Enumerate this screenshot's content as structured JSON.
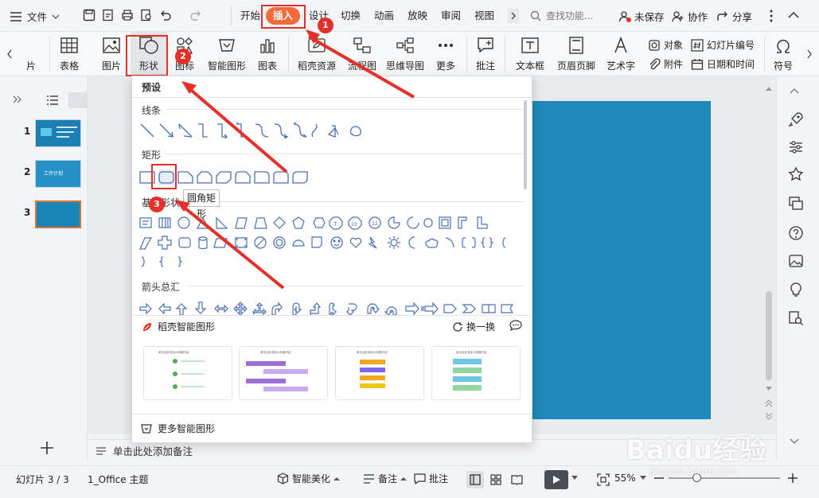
{
  "menubar": {
    "file_label": "文件",
    "tabs": [
      "开始",
      "插入",
      "设计",
      "切换",
      "动画",
      "放映",
      "审阅",
      "视图"
    ],
    "search_placeholder": "查找功能...",
    "unsaved": "未保存",
    "collab": "协作",
    "share": "分享"
  },
  "ribbon": {
    "picture_partial": "片",
    "table": "表格",
    "picture": "图片",
    "shape": "形状",
    "icon": "图标",
    "smart_shape": "智能图形",
    "chart": "图表",
    "daoke_resources": "稻壳资源",
    "flowchart": "流程图",
    "mindmap": "思维导图",
    "more": "更多",
    "comment": "批注",
    "textbox": "文本框",
    "header_footer": "页眉页脚",
    "wordart": "艺术字",
    "object": "对象",
    "attachment": "附件",
    "slide_number": "幻灯片编号",
    "date_time": "日期和时间",
    "symbol": "符号"
  },
  "dropdown": {
    "preset": "预设",
    "lines": "线条",
    "rectangles": "矩形",
    "basic_shapes": "基本形状",
    "arrows": "箭头总汇",
    "smart_title": "稻壳智能图形",
    "refresh": "换一换",
    "more_smart": "更多智能图形",
    "cards": [
      {
        "title": "单击此处添加大标题内容"
      },
      {
        "title": "单击此处添加大标题内容"
      },
      {
        "title": "单击此处添加大标题内容"
      },
      {
        "title": "单击此处添加大标题内容"
      }
    ]
  },
  "tooltip": "圆角矩形",
  "slides": {
    "numbers": [
      "1",
      "2",
      "3"
    ],
    "thumb2_text": "工作计划"
  },
  "notes_placeholder": "单击此处添加备注",
  "status": {
    "slide_info": "幻灯片 3 / 3",
    "theme": "1_Office 主题",
    "smart_beautify": "智能美化",
    "notes": "备注",
    "comments": "批注",
    "zoom": "55%"
  },
  "annotations": {
    "badge1": "1",
    "badge2": "2",
    "badge3": "3"
  },
  "watermark": {
    "main": "Baidu经验",
    "sub": "jingyan.baidu.com"
  },
  "colors": {
    "accent": "#f26b3a",
    "slide_blue": "#1f88bd",
    "annotation_red": "#e5302a"
  }
}
